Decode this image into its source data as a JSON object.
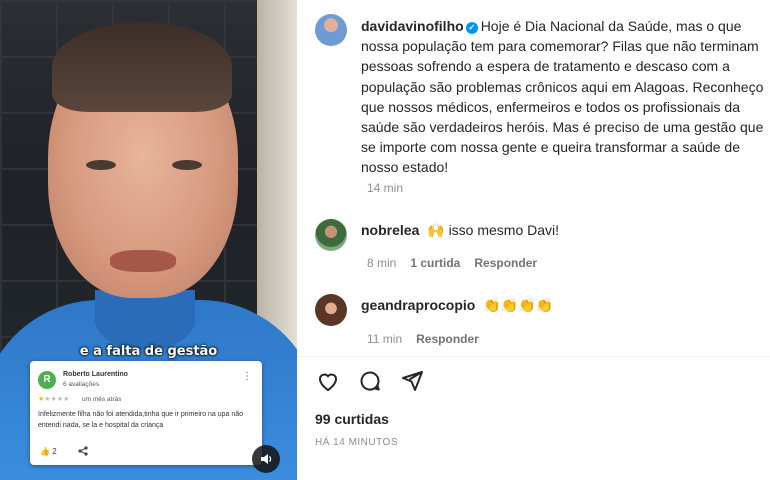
{
  "video": {
    "caption": "e a falta de gestão",
    "review": {
      "avatar_letter": "R",
      "reviewer_name": "Roberto Laurentino",
      "reviewer_count": "6 avaliações",
      "rating": 1,
      "rating_max": 5,
      "date": "um mês atrás",
      "text": "Infelizmente filha não foi atendida,tinha que ir primeiro na upa não entendi nada, se la e hospital da criança",
      "likes": "2",
      "menu_icon": "more-vert-icon",
      "share_icon": "share-icon",
      "like_icon": "thumb-up-icon"
    },
    "sound_icon": "speaker-icon"
  },
  "post": {
    "author": "davidavinofilho",
    "verified": true,
    "caption_lines": [
      "Hoje é Dia Nacional da Saúde, mas o que",
      "nossa população tem para comemorar? Filas que não terminam",
      "pessoas sofrendo a espera de tratamento e descaso com a",
      "população são problemas crônicos aqui em Alagoas. Reconheço",
      "que nossos médicos, enfermeiros e todos os profissionais da",
      "saúde são verdadeiros heróis. Mas é preciso de uma gestão que",
      "se importe com nossa gente e queira transformar a saúde de",
      "nosso estado!"
    ],
    "caption_time": "14 min",
    "comments": [
      {
        "username": "nobrelea",
        "text": "🙌 isso mesmo Davi!",
        "time": "8 min",
        "likes": "1 curtida",
        "reply": "Responder"
      },
      {
        "username": "geandraprocopio",
        "text": "👏👏👏👏",
        "time": "11 min",
        "likes": "",
        "reply": "Responder"
      }
    ],
    "actions": [
      "heart-icon",
      "comment-icon",
      "share-icon"
    ],
    "likes_count": "99 curtidas",
    "time_ago": "HÁ 14 MINUTOS"
  },
  "colors": {
    "verified_blue": "#0095f6",
    "text": "#262626",
    "muted": "#8e8e8e"
  }
}
